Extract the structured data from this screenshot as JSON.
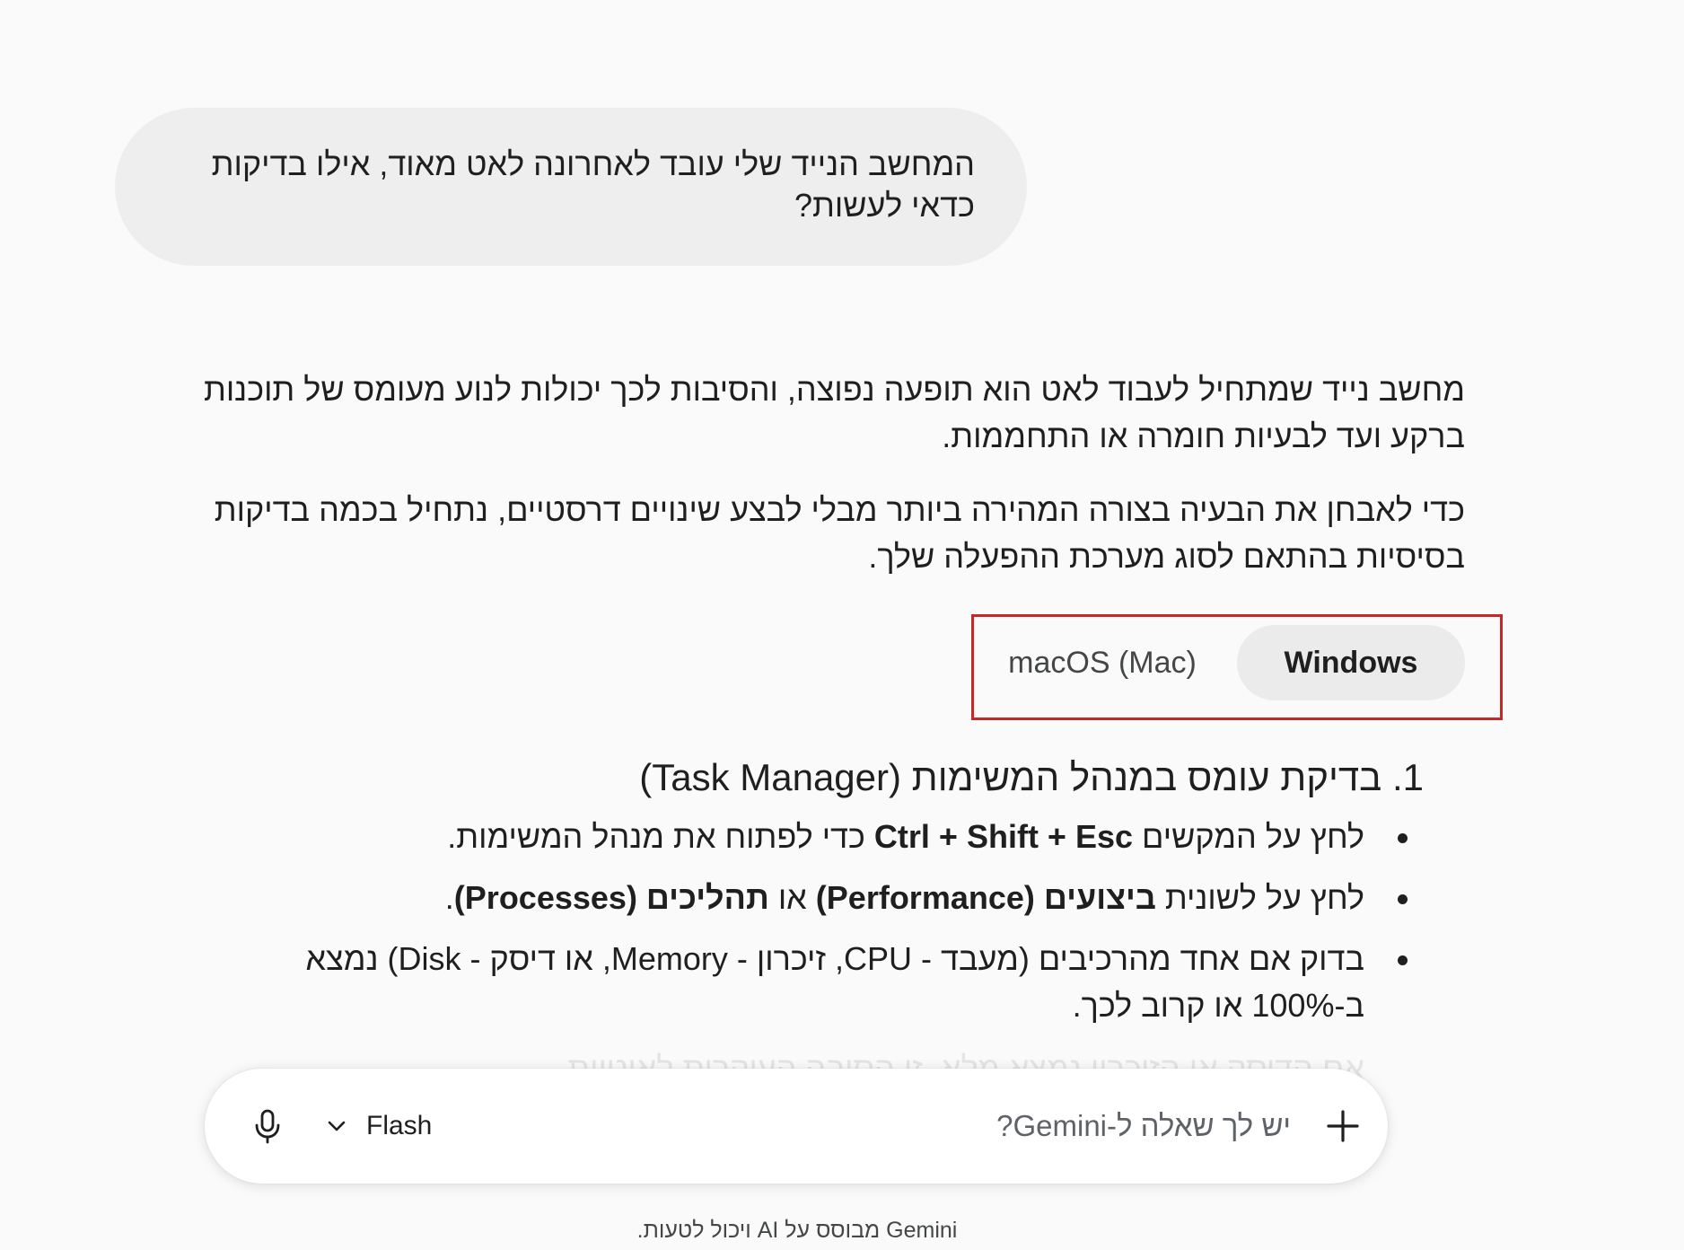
{
  "user_message": {
    "text": "המחשב הנייד שלי עובד לאחרונה לאט מאוד, אילו בדיקות כדאי לעשות?"
  },
  "response": {
    "paragraphs": [
      "מחשב נייד שמתחיל לעבוד לאט הוא תופעה נפוצה, והסיבות לכך יכולות לנוע מעומס של תוכנות ברקע ועד לבעיות חומרה או התחממות.",
      "כדי לאבחן את הבעיה בצורה המהירה ביותר מבלי לבצע שינויים דרסטיים, נתחיל בכמה בדיקות בסיסיות בהתאם לסוג מערכת ההפעלה שלך."
    ],
    "os_tabs": {
      "windows_label": "Windows",
      "macos_label": "macOS (Mac)",
      "selected": "Windows",
      "highlight_color": "#c62828"
    },
    "section_heading": "1. בדיקת עומס במנהל המשימות (Task Manager)",
    "bullets": [
      {
        "before": "לחץ על המקשים ",
        "bold": "Ctrl + Shift + Esc",
        "after": " כדי לפתוח את מנהל המשימות."
      },
      {
        "before": "לחץ על לשונית ",
        "bold1": "ביצועים (Performance)",
        "middle": " או ",
        "bold2": "תהליכים (Processes)",
        "after": "."
      },
      {
        "text": "בדוק אם אחד מהרכיבים (מעבד - CPU, זיכרון - Memory, או דיסק - Disk) נמצא ב-100% או קרוב לכך."
      }
    ],
    "faded_text": "אם הדיסק או הזיכרון נמצא מלא, זו הסיבה העיקרית לאיטיות"
  },
  "composer": {
    "placeholder": "יש לך שאלה ל-Gemini?",
    "model_label": "Flash",
    "icons": {
      "add": "plus-icon",
      "model_dropdown": "chevron-down-icon",
      "mic": "microphone-icon"
    }
  },
  "disclaimer": "Gemini מבוסס על AI ויכול לטעות."
}
